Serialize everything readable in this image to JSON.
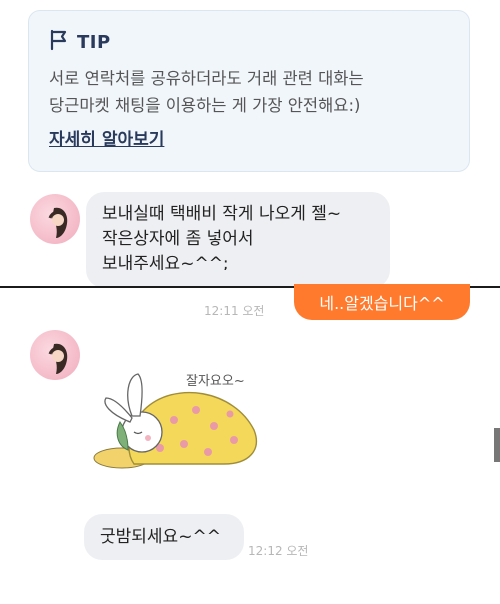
{
  "tip": {
    "title": "TIP",
    "line1": "서로 연락처를 공유하더라도 거래 관련 대화는",
    "line2": "당근마켓 채팅을 이용하는 게 가장 안전해요:)",
    "link": "자세히 알아보기"
  },
  "messages": {
    "m1": {
      "line1": "보내실때 택배비 작게 나오게 젤~",
      "line2": "작은상자에 좀 넣어서",
      "line3": "보내주세요~^^;"
    },
    "reply": "네..알겠습니다^^",
    "reply_time": "12:11 오전",
    "sticker_caption": "잘자요오~",
    "m2": "굿밤되세요~^^",
    "m2_time": "12:12 오전"
  },
  "icons": [
    "flag-icon",
    "avatar-icon"
  ],
  "colors": {
    "accent": "#ff7a2d",
    "tip_bg": "#f1f6fb",
    "incoming_bubble": "#eeeff2"
  }
}
